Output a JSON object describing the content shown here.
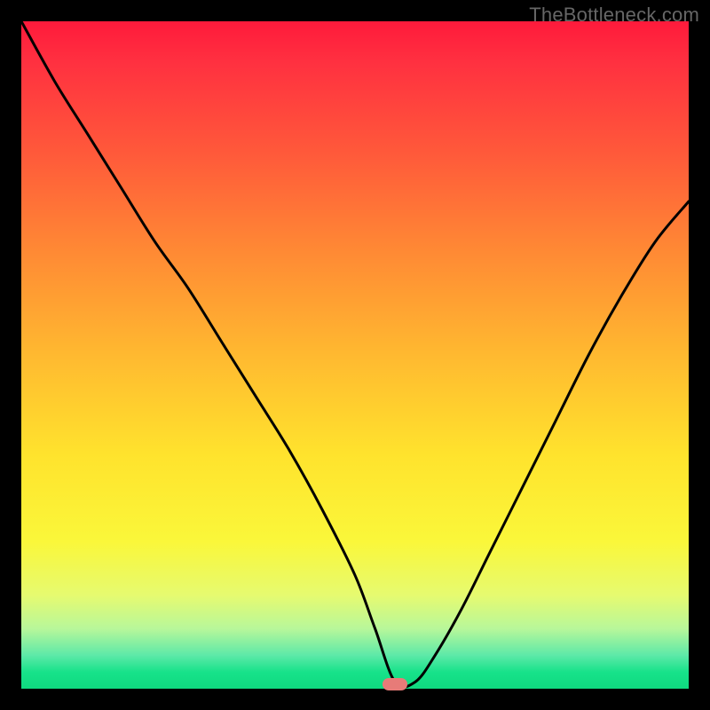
{
  "watermark": "TheBottleneck.com",
  "colors": {
    "background": "#000000",
    "curve": "#000000",
    "marker": "#e77b78",
    "gradient_top": "#ff1a3b",
    "gradient_bottom": "#0fd97f"
  },
  "plot": {
    "inner_left": 24,
    "inner_top": 24,
    "inner_width": 752,
    "inner_height": 752
  },
  "marker": {
    "x_pct": 56,
    "y_pct": 99.3
  },
  "chart_data": {
    "type": "line",
    "title": "",
    "xlabel": "",
    "ylabel": "",
    "xlim": [
      0,
      100
    ],
    "ylim": [
      0,
      100
    ],
    "grid": false,
    "series": [
      {
        "name": "bottleneck-curve",
        "x": [
          0,
          5,
          10,
          15,
          20,
          25,
          30,
          35,
          40,
          45,
          50,
          53,
          56,
          59,
          62,
          66,
          70,
          75,
          80,
          85,
          90,
          95,
          100
        ],
        "y": [
          100,
          91,
          83,
          75,
          67,
          60,
          52,
          44,
          36,
          27,
          17,
          9,
          1,
          1,
          5,
          12,
          20,
          30,
          40,
          50,
          59,
          67,
          73
        ]
      }
    ],
    "marker": {
      "x": 56,
      "y": 1
    },
    "color_field": "gradient from red (high bottleneck) through yellow to green (optimal)",
    "note": "Curve shows bottleneck percentage vs component balance; valley near x=56 is optimal (green)."
  }
}
